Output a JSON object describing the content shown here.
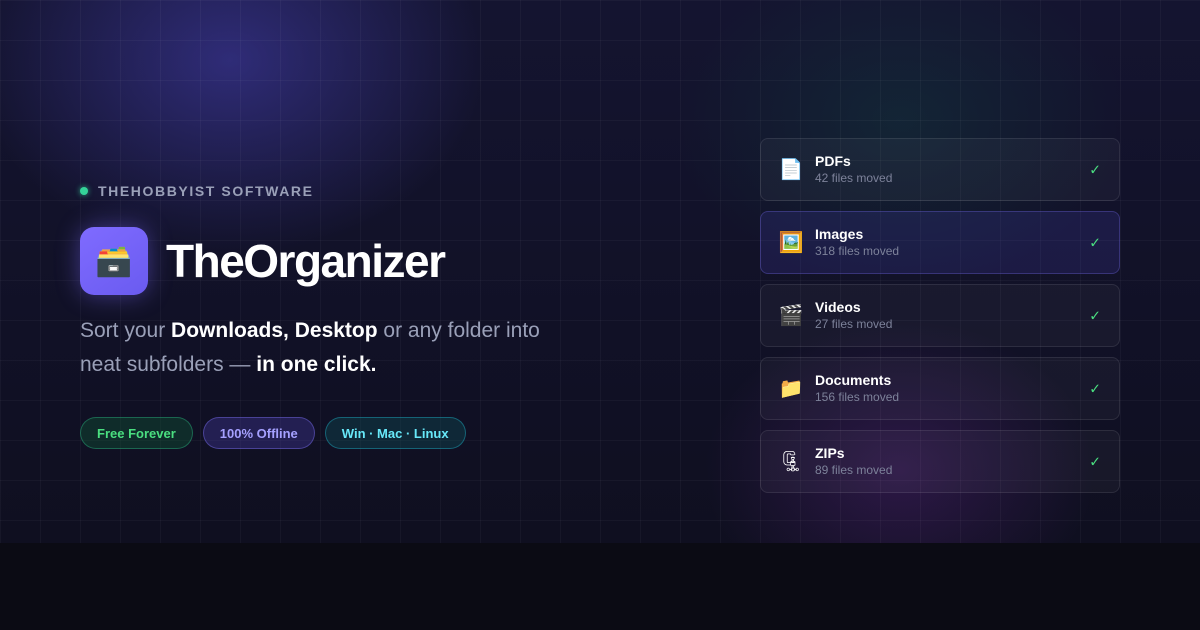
{
  "brand": {
    "label": "THEHOBBYIST SOFTWARE"
  },
  "app": {
    "title": "TheOrganizer",
    "icon": "folder-box-icon"
  },
  "tagline": {
    "part1": "Sort your ",
    "bold1": "Downloads, Desktop",
    "part2": " or any folder into neat subfolders — ",
    "bold2": "in one click."
  },
  "badges": [
    {
      "label": "Free Forever",
      "color": "#4ade80"
    },
    {
      "label": "100% Offline",
      "color": "#a5a0ff"
    },
    {
      "label": "Win · Mac · Linux",
      "color": "#67e8f9"
    }
  ],
  "file_list": [
    {
      "name": "PDFs",
      "count": "42 files moved",
      "icon": "document-page-icon",
      "glyph": "📄",
      "status": "✓"
    },
    {
      "name": "Images",
      "count": "318 files moved",
      "icon": "framed-picture-icon",
      "glyph": "🖼️",
      "status": "✓"
    },
    {
      "name": "Videos",
      "count": "27 files moved",
      "icon": "clapper-board-icon",
      "glyph": "🎬",
      "status": "✓"
    },
    {
      "name": "Documents",
      "count": "156 files moved",
      "icon": "folder-icon",
      "glyph": "📁",
      "status": "✓"
    },
    {
      "name": "ZIPs",
      "count": "89 files moved",
      "icon": "compression-clamp-icon",
      "glyph": "🗜",
      "status": "✓"
    }
  ],
  "colors": {
    "accent": "#7c6aff",
    "success": "#4ade80",
    "background": "#0b0b14"
  }
}
